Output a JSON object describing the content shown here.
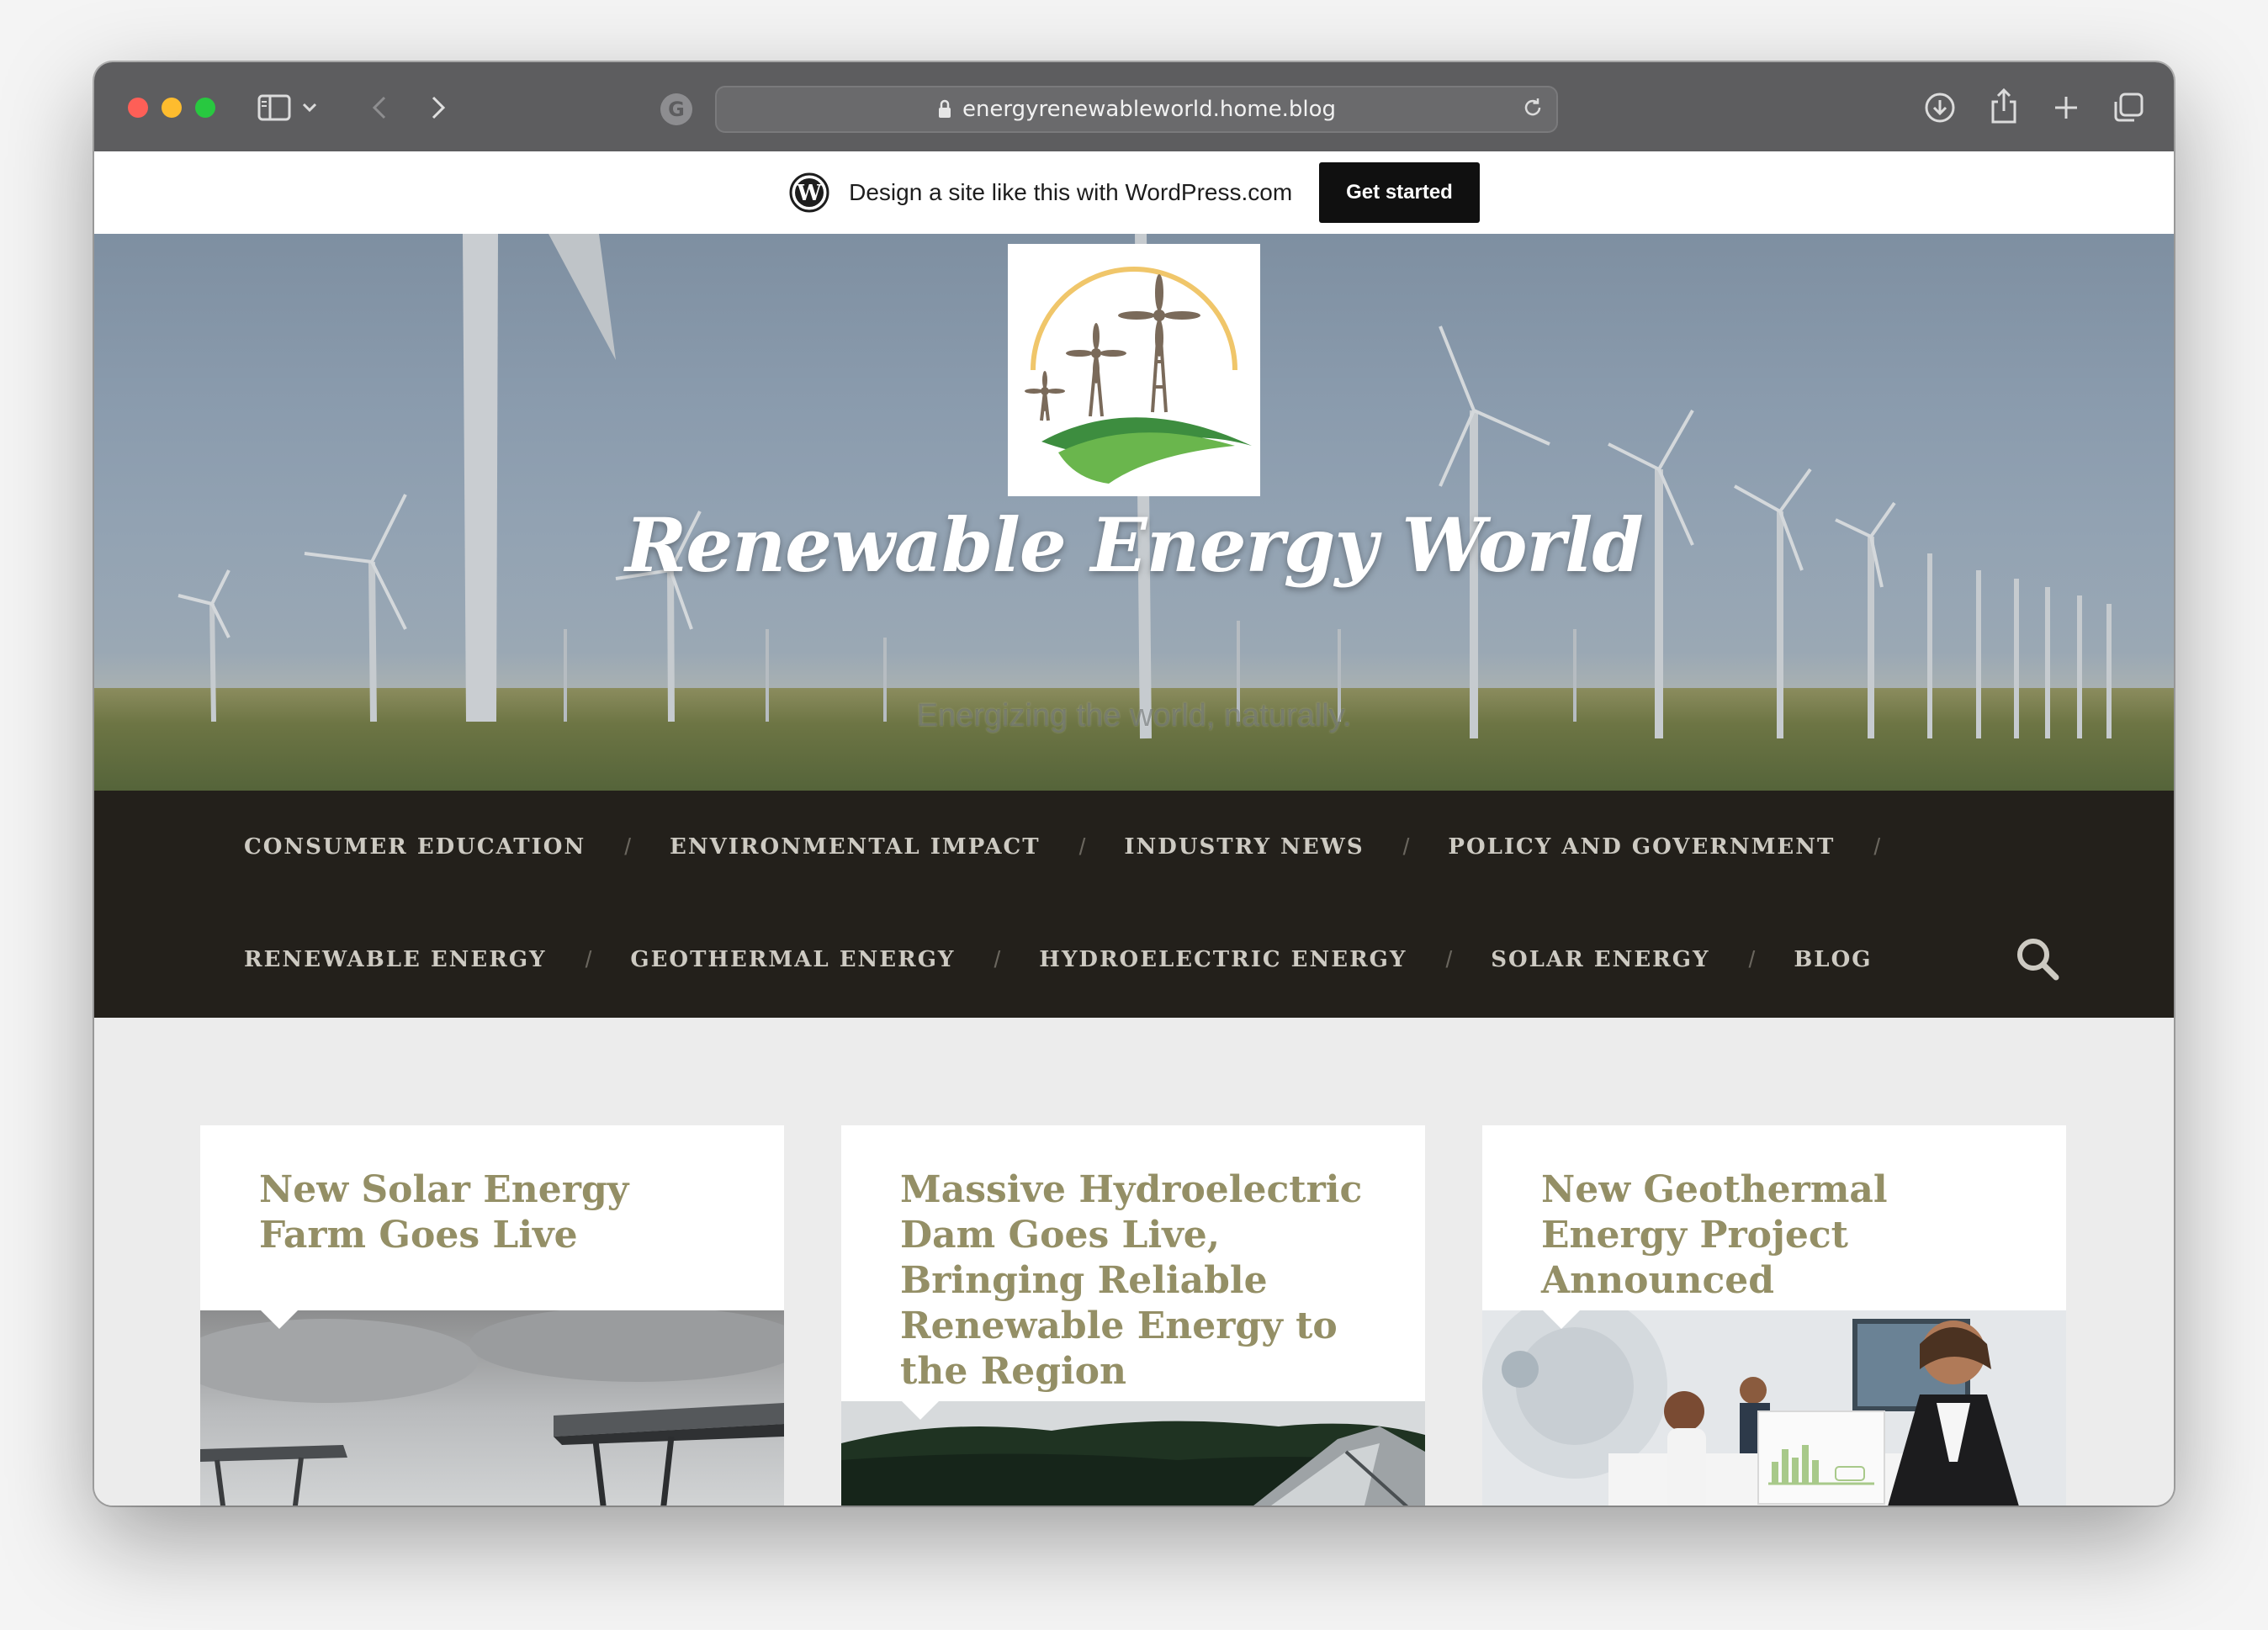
{
  "browser": {
    "url": "energyrenewableworld.home.blog"
  },
  "wp_banner": {
    "text": "Design a site like this with WordPress.com",
    "button": "Get started"
  },
  "site": {
    "title": "Renewable Energy World",
    "tagline": "Energizing the world, naturally."
  },
  "nav": {
    "row1": [
      "Consumer Education",
      "Environmental Impact",
      "Industry News",
      "Policy and Government"
    ],
    "row2": [
      "Renewable Energy",
      "Geothermal Energy",
      "Hydroelectric Energy",
      "Solar Energy",
      "Blog"
    ],
    "separator": "/"
  },
  "posts": [
    {
      "title": "New Solar Energy Farm Goes Live"
    },
    {
      "title": "Massive Hydroelectric Dam Goes Live, Bringing Reliable Renewable Energy to the Region"
    },
    {
      "title": "New Geothermal Energy Project Announced"
    }
  ],
  "colors": {
    "nav_bg": "#23201b",
    "post_title": "#948f66",
    "content_bg": "#ececec"
  }
}
